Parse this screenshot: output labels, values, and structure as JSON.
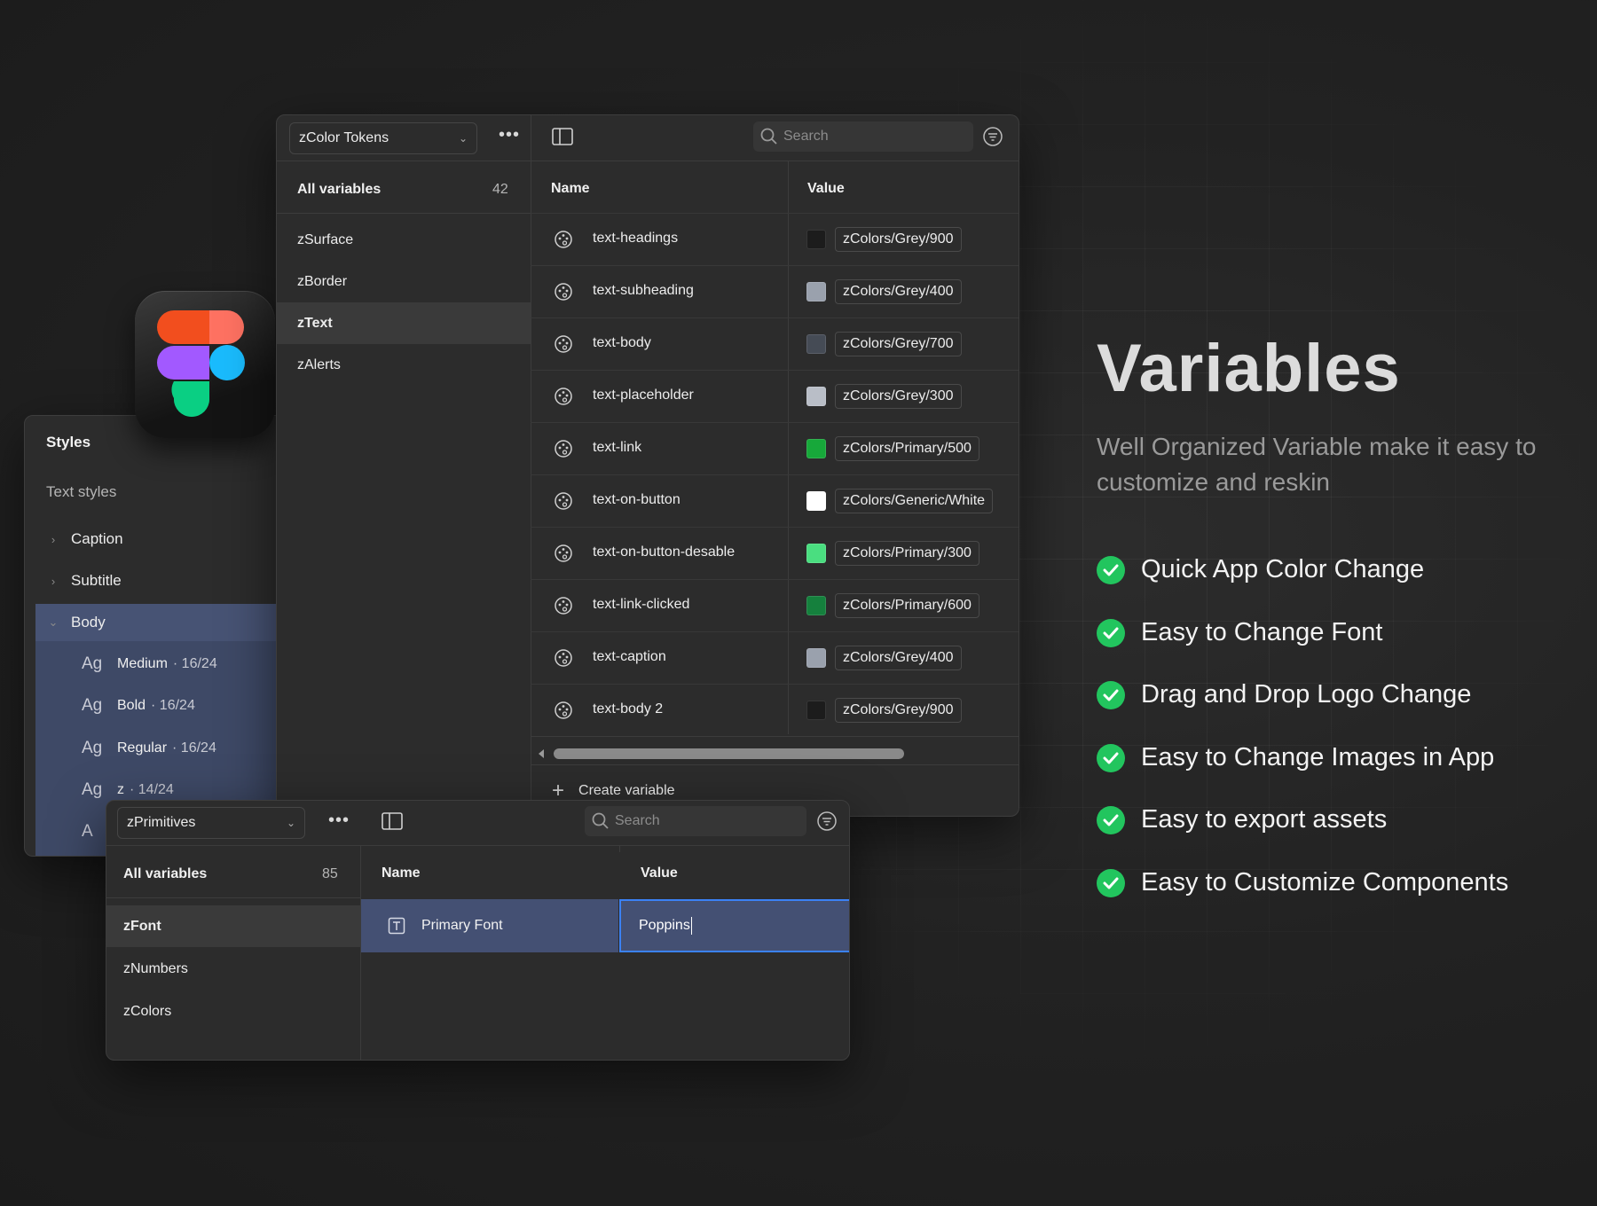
{
  "styles_panel": {
    "title": "Styles",
    "section": "Text styles",
    "groups": [
      {
        "label": "Caption"
      },
      {
        "label": "Subtitle"
      },
      {
        "label": "Body"
      }
    ],
    "body_items": [
      {
        "ag": "Ag",
        "name": "Medium",
        "meta": "· 16/24"
      },
      {
        "ag": "Ag",
        "name": "Bold",
        "meta": "· 16/24"
      },
      {
        "ag": "Ag",
        "name": "Regular",
        "meta": "· 16/24"
      },
      {
        "ag": "Ag",
        "name": "z",
        "meta": "· 14/24"
      },
      {
        "ag": "A"
      }
    ]
  },
  "main_panel": {
    "collection": "zColor Tokens",
    "search_placeholder": "Search",
    "all_variables_label": "All variables",
    "all_variables_count": "42",
    "groups": [
      {
        "label": "zSurface"
      },
      {
        "label": "zBorder"
      },
      {
        "label": "zText"
      },
      {
        "label": "zAlerts"
      }
    ],
    "active_group": "zText",
    "columns": {
      "name": "Name",
      "value": "Value"
    },
    "rows": [
      {
        "name": "text-headings",
        "value": "zColors/Grey/900",
        "swatch": "#1c1c1c"
      },
      {
        "name": "text-subheading",
        "value": "zColors/Grey/400",
        "swatch": "#9aa1ad"
      },
      {
        "name": "text-body",
        "value": "zColors/Grey/700",
        "swatch": "#454b55"
      },
      {
        "name": "text-placeholder",
        "value": "zColors/Grey/300",
        "swatch": "#b9bec7"
      },
      {
        "name": "text-link",
        "value": "zColors/Primary/500",
        "swatch": "#17a83a"
      },
      {
        "name": "text-on-button",
        "value": "zColors/Generic/White",
        "swatch": "#ffffff"
      },
      {
        "name": "text-on-button-desable",
        "value": "zColors/Primary/300",
        "swatch": "#4ade80"
      },
      {
        "name": "text-link-clicked",
        "value": "zColors/Primary/600",
        "swatch": "#15803d"
      },
      {
        "name": "text-caption",
        "value": "zColors/Grey/400",
        "swatch": "#9aa1ad"
      },
      {
        "name": "text-body 2",
        "value": "zColors/Grey/900",
        "swatch": "#1c1c1c"
      }
    ],
    "create_label": "Create variable"
  },
  "prim_panel": {
    "collection": "zPrimitives",
    "search_placeholder": "Search",
    "all_variables_label": "All variables",
    "all_variables_count": "85",
    "groups": [
      {
        "label": "zFont"
      },
      {
        "label": "zNumbers"
      },
      {
        "label": "zColors"
      }
    ],
    "columns": {
      "name": "Name",
      "value": "Value"
    },
    "row": {
      "name": "Primary Font",
      "value": "Poppins"
    }
  },
  "hero": {
    "title": "Variables",
    "subtitle": "Well Organized Variable make it easy to customize and reskin",
    "features": [
      "Quick App Color Change",
      "Easy to Change Font",
      "Drag and Drop Logo Change",
      "Easy to Change Images in App",
      "Easy to export assets",
      "Easy to Customize Components"
    ],
    "check_color": "#22c55e"
  }
}
